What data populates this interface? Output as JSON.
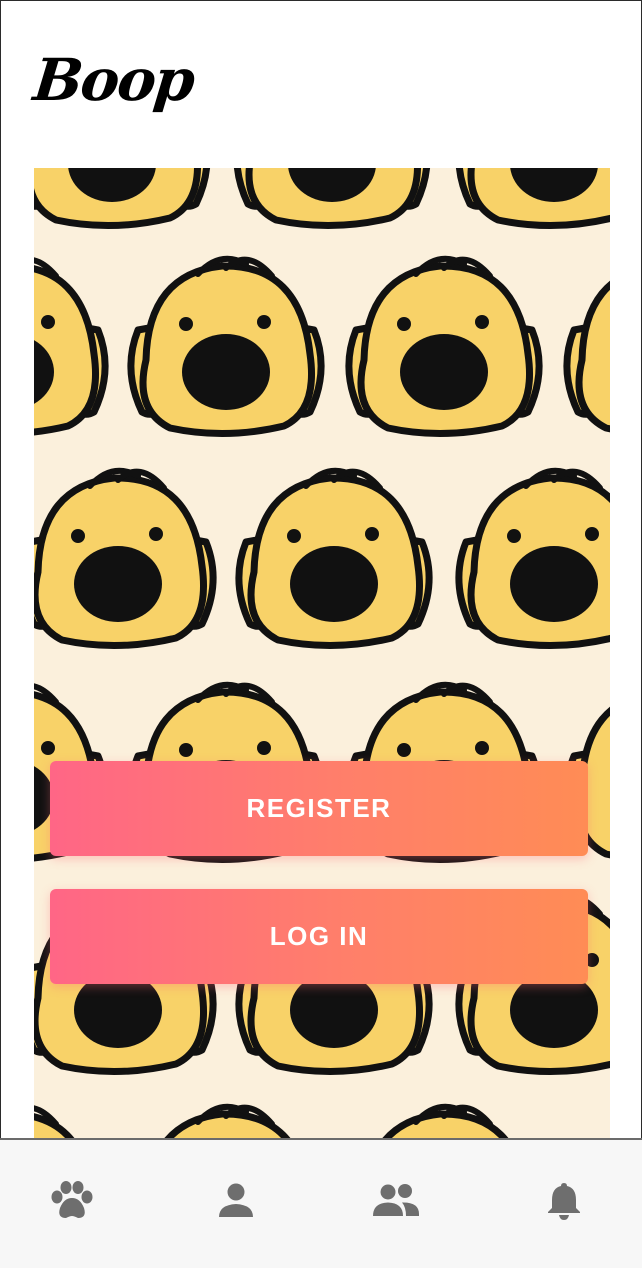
{
  "app": {
    "logo_text": "Boop"
  },
  "hero": {
    "pattern": "yellow-dog-faces",
    "background_color": "#fbf0dc",
    "face_color": "#f8d268"
  },
  "actions": {
    "register_label": "REGISTER",
    "login_label": "LOG IN"
  },
  "tabbar": {
    "items": [
      {
        "icon": "paw-icon"
      },
      {
        "icon": "person-icon"
      },
      {
        "icon": "group-icon"
      },
      {
        "icon": "bell-icon"
      }
    ]
  },
  "colors": {
    "button_gradient_start": "#ff6686",
    "button_gradient_end": "#ff8c55",
    "tab_icon": "#6e6e6e"
  }
}
